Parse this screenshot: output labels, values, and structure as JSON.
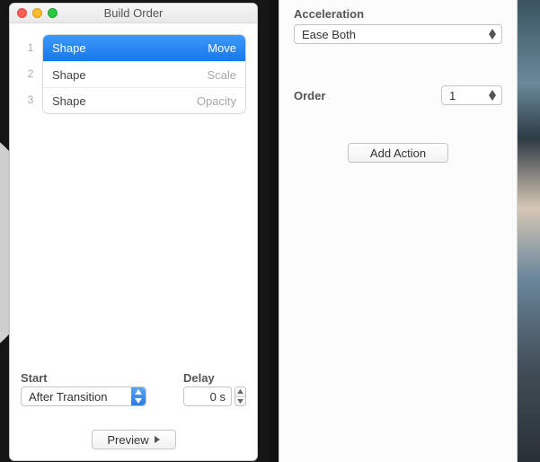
{
  "window": {
    "title": "Build Order"
  },
  "builds": [
    {
      "index": "1",
      "name": "Shape",
      "effect": "Move",
      "selected": true
    },
    {
      "index": "2",
      "name": "Shape",
      "effect": "Scale",
      "selected": false
    },
    {
      "index": "3",
      "name": "Shape",
      "effect": "Opacity",
      "selected": false
    }
  ],
  "start": {
    "label": "Start",
    "value": "After Transition"
  },
  "delay": {
    "label": "Delay",
    "value": "0 s"
  },
  "preview": {
    "label": "Preview"
  },
  "inspector": {
    "acceleration": {
      "label": "Acceleration",
      "value": "Ease Both"
    },
    "order": {
      "label": "Order",
      "value": "1"
    },
    "add_action": {
      "label": "Add Action"
    }
  }
}
